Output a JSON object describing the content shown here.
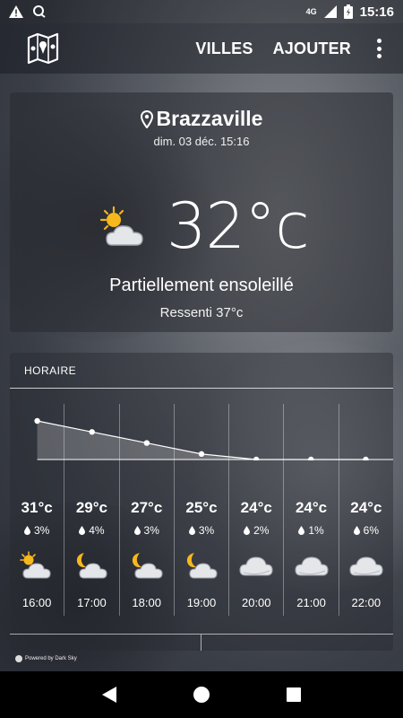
{
  "status_bar": {
    "time": "15:16",
    "network": "4G",
    "icons": [
      "warning-icon",
      "voicemail-icon",
      "signal-icon",
      "battery-icon"
    ]
  },
  "app_bar": {
    "logo_icon": "map-icon",
    "actions": [
      {
        "label": "VILLES"
      },
      {
        "label": "AJOUTER"
      }
    ],
    "menu_icon": "more-vert-icon"
  },
  "current": {
    "city": "Brazzaville",
    "datetime": "dim. 03 déc. 15:16",
    "temperature": "32°c",
    "description": "Partiellement ensoleillé",
    "feels_like": "Ressenti 37°c",
    "icon": "partly-cloudy-day-icon"
  },
  "hourly": {
    "header": "HORAIRE",
    "chart_data": {
      "type": "line",
      "x": [
        "16:00",
        "17:00",
        "18:00",
        "19:00",
        "20:00",
        "21:00",
        "22:00"
      ],
      "series": [
        {
          "values": [
            31,
            29,
            27,
            25,
            24,
            24,
            24
          ]
        }
      ]
    },
    "items": [
      {
        "temp": "31°c",
        "precip": "3%",
        "time": "16:00",
        "icon": "partly-cloudy-day-icon"
      },
      {
        "temp": "29°c",
        "precip": "4%",
        "time": "17:00",
        "icon": "partly-cloudy-night-icon"
      },
      {
        "temp": "27°c",
        "precip": "3%",
        "time": "18:00",
        "icon": "partly-cloudy-night-icon"
      },
      {
        "temp": "25°c",
        "precip": "3%",
        "time": "19:00",
        "icon": "partly-cloudy-night-icon"
      },
      {
        "temp": "24°c",
        "precip": "2%",
        "time": "20:00",
        "icon": "cloudy-icon"
      },
      {
        "temp": "24°c",
        "precip": "1%",
        "time": "21:00",
        "icon": "cloudy-icon"
      },
      {
        "temp": "24°c",
        "precip": "6%",
        "time": "22:00",
        "icon": "cloudy-icon"
      }
    ]
  },
  "powered_by": "Powered by Dark Sky",
  "nav": {
    "buttons": [
      "back-icon",
      "home-icon",
      "recents-icon"
    ]
  }
}
